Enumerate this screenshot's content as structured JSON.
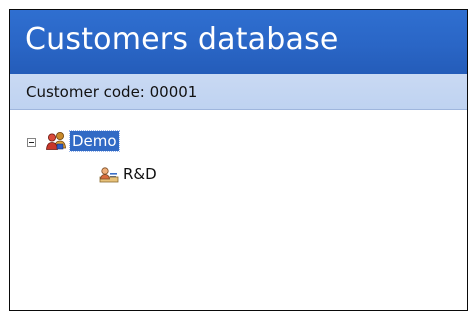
{
  "window": {
    "title": "Customers database"
  },
  "info_bar": {
    "customer_code_text": "Customer code: 00001"
  },
  "tree": {
    "root": {
      "label": "Demo",
      "expanded": true,
      "selected": true,
      "icon": "group-icon"
    },
    "children": [
      {
        "label": "R&D",
        "icon": "user-card-icon"
      }
    ]
  },
  "colors": {
    "title_bar": "#2a66c6",
    "info_bar": "#c6d8f3",
    "selection": "#316ac5"
  }
}
